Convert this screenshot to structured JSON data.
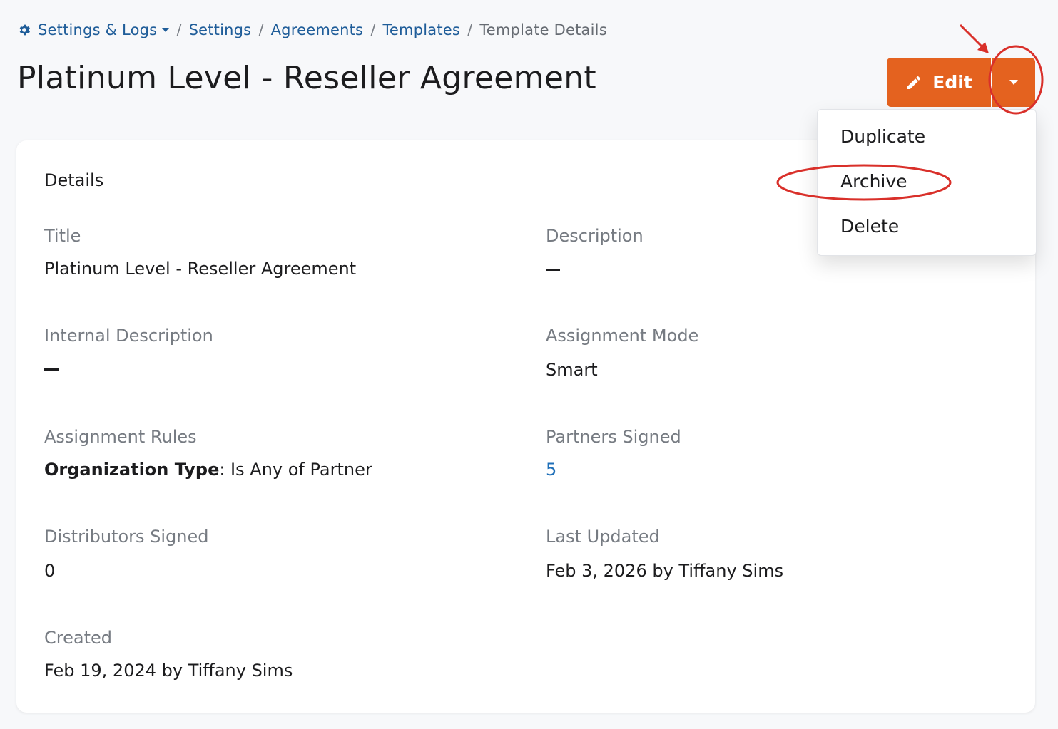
{
  "breadcrumb": {
    "root": "Settings & Logs",
    "items": [
      "Settings",
      "Agreements",
      "Templates"
    ],
    "current": "Template Details"
  },
  "page_title": "Platinum Level - Reseller Agreement",
  "actions": {
    "edit_label": "Edit",
    "dropdown_items": [
      "Duplicate",
      "Archive",
      "Delete"
    ]
  },
  "details": {
    "section_title": "Details",
    "fields": {
      "title": {
        "label": "Title",
        "value": "Platinum Level - Reseller Agreement"
      },
      "description": {
        "label": "Description",
        "value": "—"
      },
      "internal_description": {
        "label": "Internal Description",
        "value": "—"
      },
      "assignment_mode": {
        "label": "Assignment Mode",
        "value": "Smart"
      },
      "assignment_rules": {
        "label": "Assignment Rules",
        "rule_key": "Organization Type",
        "rule_value": ": Is Any of Partner"
      },
      "partners_signed": {
        "label": "Partners Signed",
        "value": "5"
      },
      "distributors_signed": {
        "label": "Distributors Signed",
        "value": "0"
      },
      "last_updated": {
        "label": "Last Updated",
        "value": "Feb 3, 2026 by Tiffany Sims"
      },
      "created": {
        "label": "Created",
        "value": "Feb 19, 2024 by Tiffany Sims"
      }
    }
  },
  "colors": {
    "accent": "#e4621f",
    "link": "#1f5d99",
    "annotation": "#d9302a"
  }
}
